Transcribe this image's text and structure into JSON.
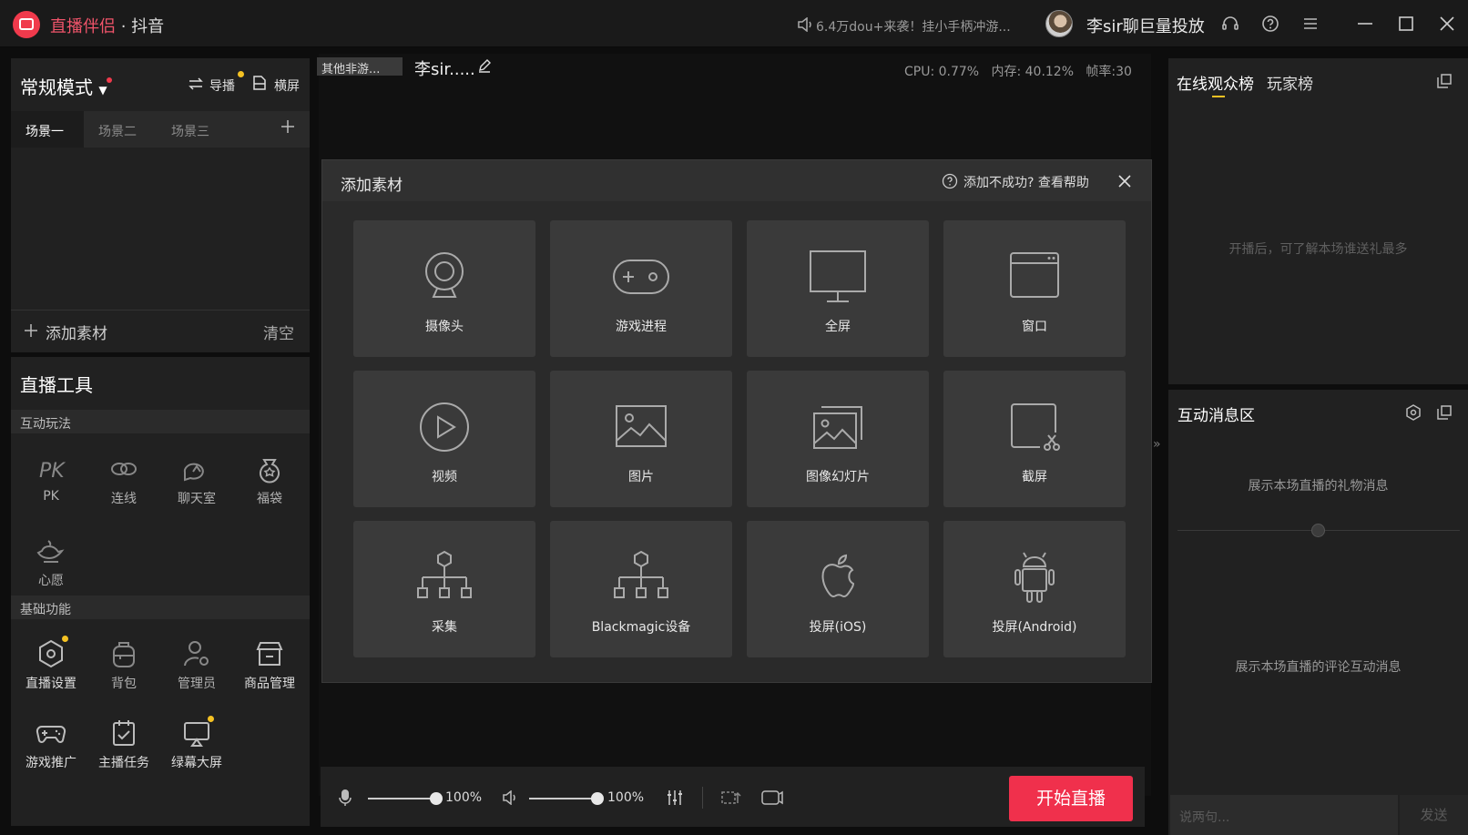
{
  "app": {
    "name": "直播伴侣",
    "separator": " · ",
    "platform": "抖音",
    "notice": "6.4万dou+来袭！挂小手柄冲游...",
    "username": "李sir聊巨量投放"
  },
  "left": {
    "mode_label": "常规模式",
    "nav_btn": "导播",
    "landscape_btn": "横屏",
    "scene_tabs": [
      "场景一",
      "场景二",
      "场景三"
    ],
    "add_material": "添加素材",
    "clear": "清空",
    "tools_title": "直播工具",
    "interactive_section": "互动玩法",
    "interactive_tools": [
      "PK",
      "连线",
      "聊天室",
      "福袋",
      "心愿"
    ],
    "basic_section": "基础功能",
    "basic_tools": [
      "直播设置",
      "背包",
      "管理员",
      "商品管理",
      "游戏推广",
      "主播任务",
      "绿幕大屏"
    ]
  },
  "center": {
    "game_tag": "其他非游...",
    "room_title": "李sir.....",
    "stats": {
      "cpu": "CPU: 0.77%",
      "mem": "内存: 40.12%",
      "fps": "帧率:30"
    }
  },
  "dialog": {
    "title": "添加素材",
    "help": "添加不成功? 查看帮助",
    "items": [
      {
        "label": "摄像头",
        "icon": "webcam-icon"
      },
      {
        "label": "游戏进程",
        "icon": "gamepad-icon"
      },
      {
        "label": "全屏",
        "icon": "monitor-icon"
      },
      {
        "label": "窗口",
        "icon": "window-icon"
      },
      {
        "label": "视频",
        "icon": "play-circle-icon"
      },
      {
        "label": "图片",
        "icon": "image-icon"
      },
      {
        "label": "图像幻灯片",
        "icon": "slideshow-icon"
      },
      {
        "label": "截屏",
        "icon": "screenshot-icon"
      },
      {
        "label": "采集",
        "icon": "capture-tree-icon"
      },
      {
        "label": "Blackmagic设备",
        "icon": "blackmagic-tree-icon"
      },
      {
        "label": "投屏(iOS)",
        "icon": "apple-icon"
      },
      {
        "label": "投屏(Android)",
        "icon": "android-icon"
      }
    ]
  },
  "bottom": {
    "mic_volume": "100%",
    "speaker_volume": "100%",
    "mic_level": 1.0,
    "speaker_level": 1.0,
    "start_btn": "开始直播"
  },
  "right": {
    "tab_online": "在线观众榜",
    "tab_players": "玩家榜",
    "empty_rank": "开播后，可了解本场谁送礼最多",
    "msg_title": "互动消息区",
    "gift_msg": "展示本场直播的礼物消息",
    "comment_msg": "展示本场直播的评论互动消息",
    "input_placeholder": "说两句...",
    "send": "发送"
  },
  "colors": {
    "accent": "#f0304c",
    "yellow": "#f5c223",
    "bg": "#212121"
  }
}
